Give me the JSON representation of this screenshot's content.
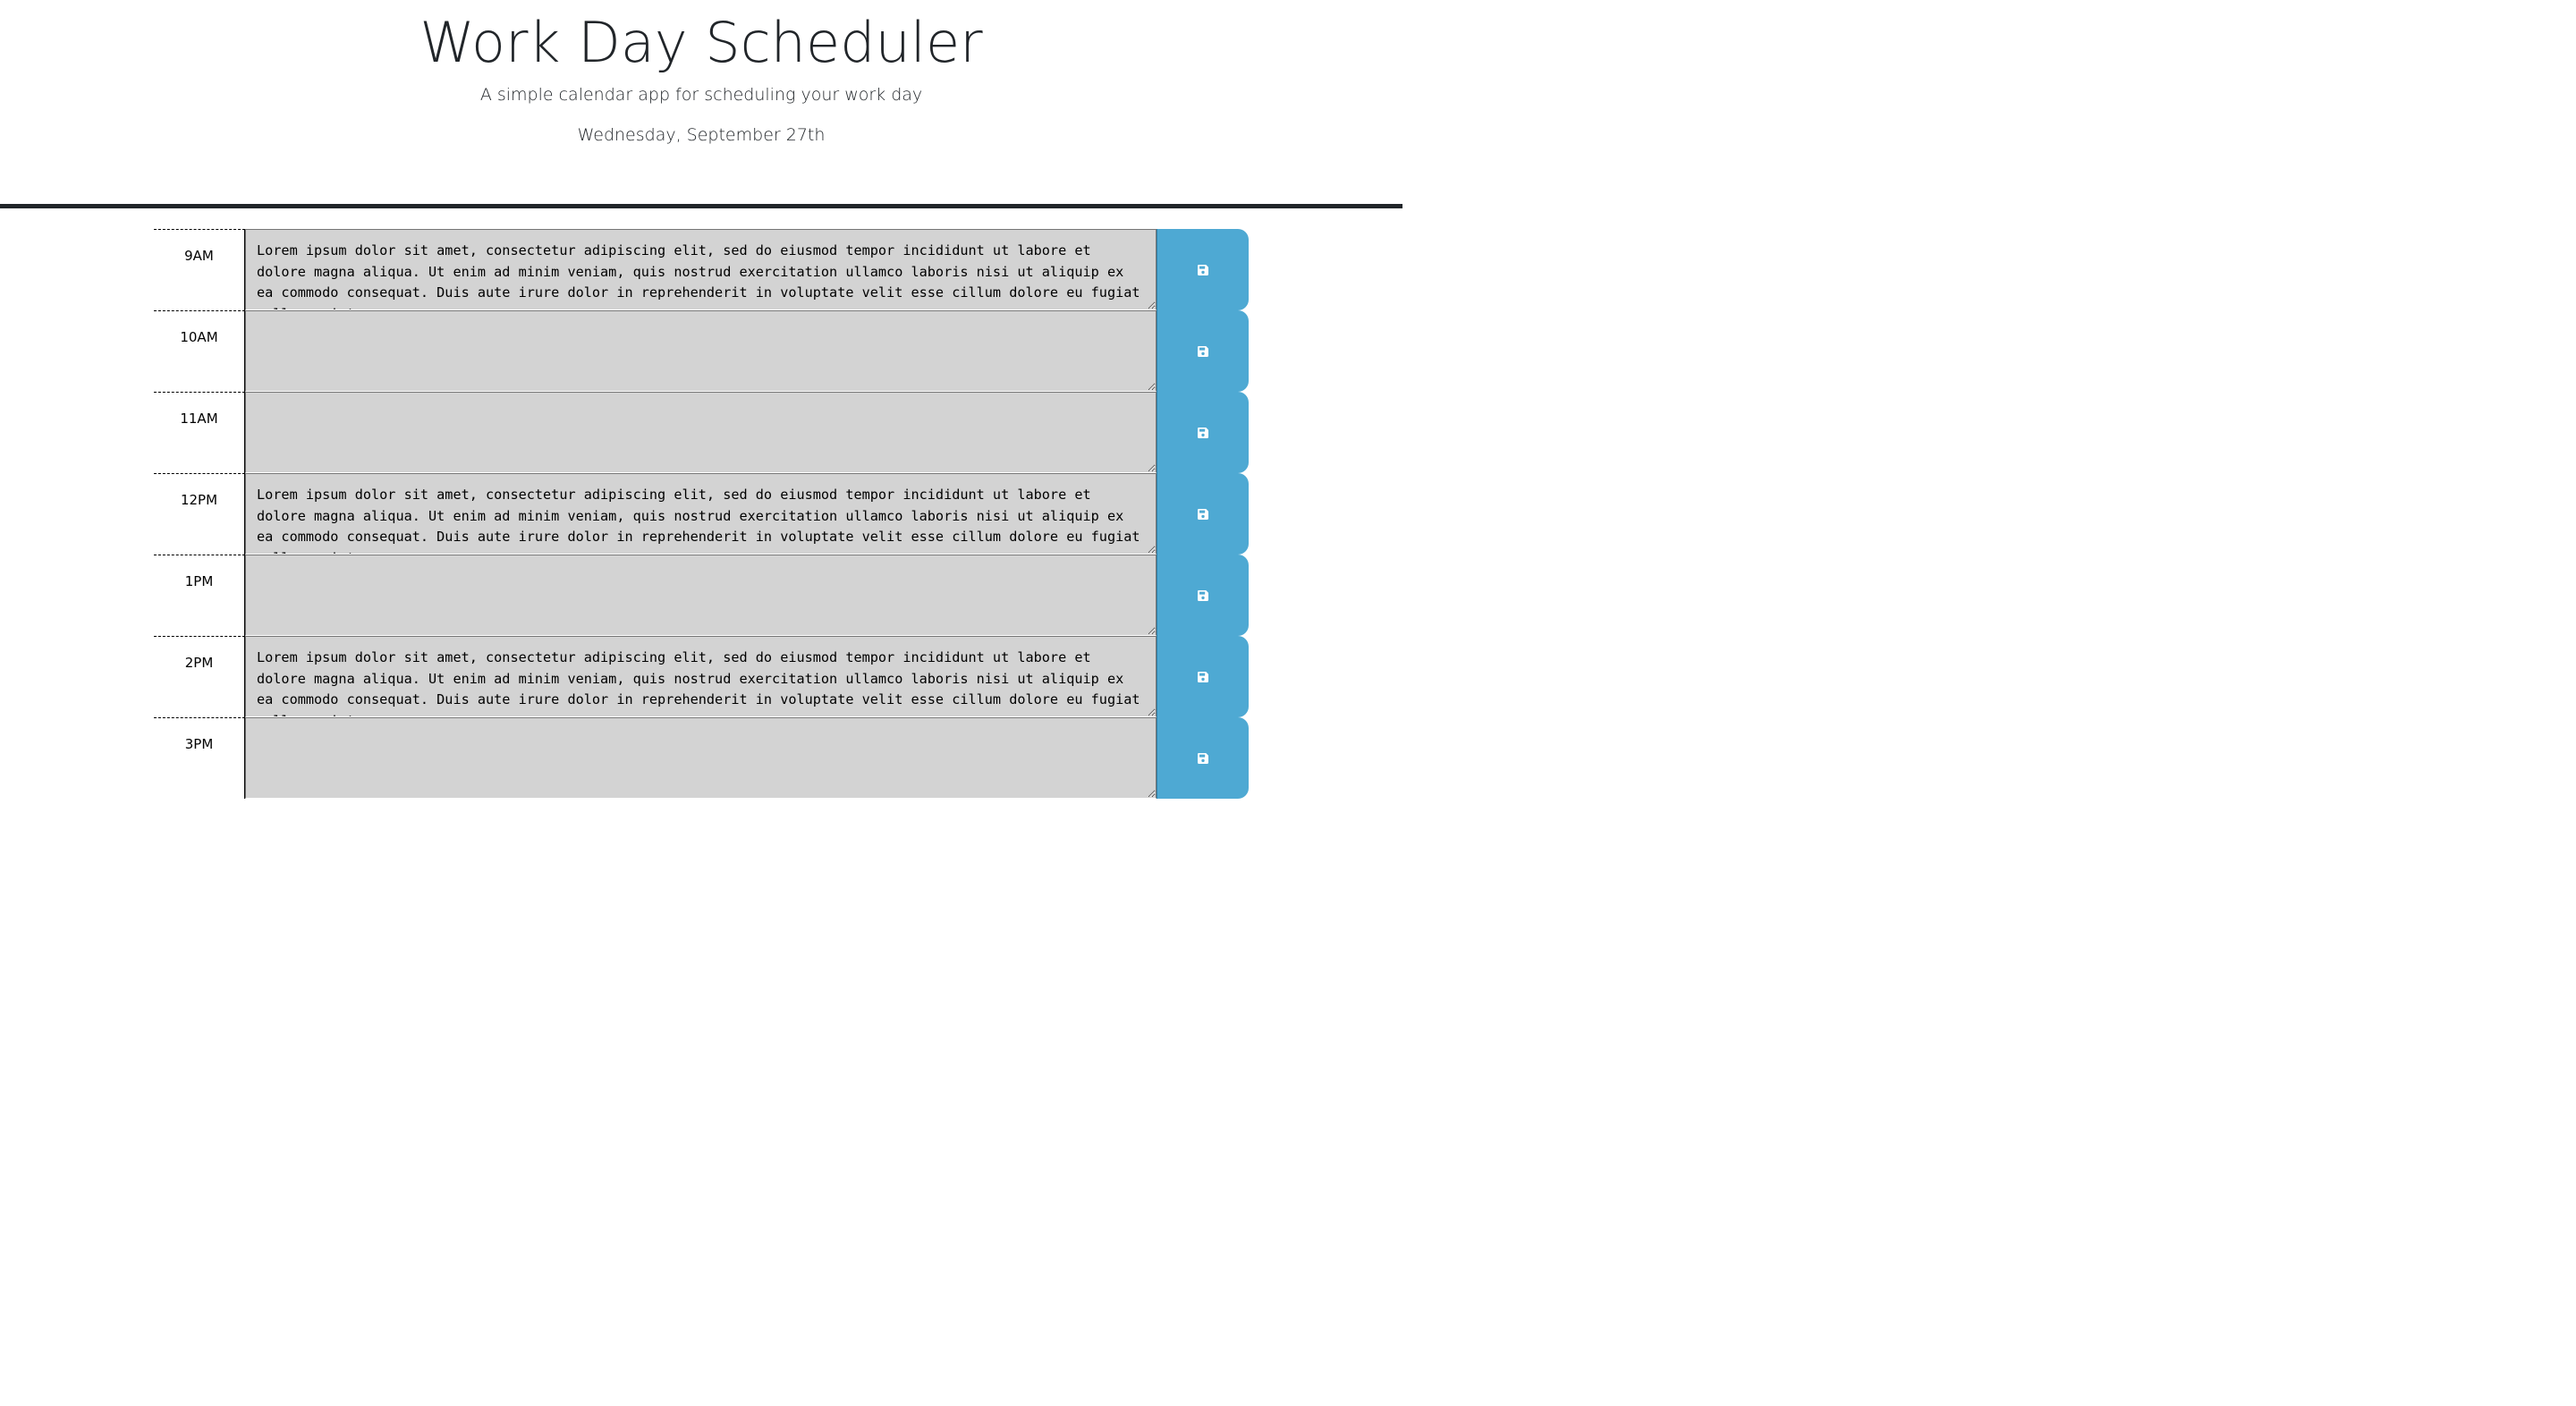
{
  "header": {
    "title": "Work Day Scheduler",
    "lead": "A simple calendar app for scheduling your work day",
    "current_day": "Wednesday, September 27th"
  },
  "colors": {
    "text": "#212529",
    "rule": "#212529",
    "row_background": "#d3d3d3",
    "save_button": "#4ea9d3",
    "save_icon": "#ffffff"
  },
  "save_icon_name": "floppy-disk-icon",
  "hours": [
    {
      "label": "9AM",
      "text": "Lorem ipsum dolor sit amet, consectetur adipiscing elit, sed do eiusmod tempor incididunt ut labore et dolore magna aliqua. Ut enim ad minim veniam, quis nostrud exercitation ullamco laboris nisi ut aliquip ex ea commodo consequat. Duis aute irure dolor in reprehenderit in voluptate velit esse cillum dolore eu fugiat nulla pariatur."
    },
    {
      "label": "10AM",
      "text": ""
    },
    {
      "label": "11AM",
      "text": ""
    },
    {
      "label": "12PM",
      "text": "Lorem ipsum dolor sit amet, consectetur adipiscing elit, sed do eiusmod tempor incididunt ut labore et dolore magna aliqua. Ut enim ad minim veniam, quis nostrud exercitation ullamco laboris nisi ut aliquip ex ea commodo consequat. Duis aute irure dolor in reprehenderit in voluptate velit esse cillum dolore eu fugiat nulla pariatur."
    },
    {
      "label": "1PM",
      "text": ""
    },
    {
      "label": "2PM",
      "text": "Lorem ipsum dolor sit amet, consectetur adipiscing elit, sed do eiusmod tempor incididunt ut labore et dolore magna aliqua. Ut enim ad minim veniam, quis nostrud exercitation ullamco laboris nisi ut aliquip ex ea commodo consequat. Duis aute irure dolor in reprehenderit in voluptate velit esse cillum dolore eu fugiat nulla pariatur."
    },
    {
      "label": "3PM",
      "text": ""
    }
  ]
}
